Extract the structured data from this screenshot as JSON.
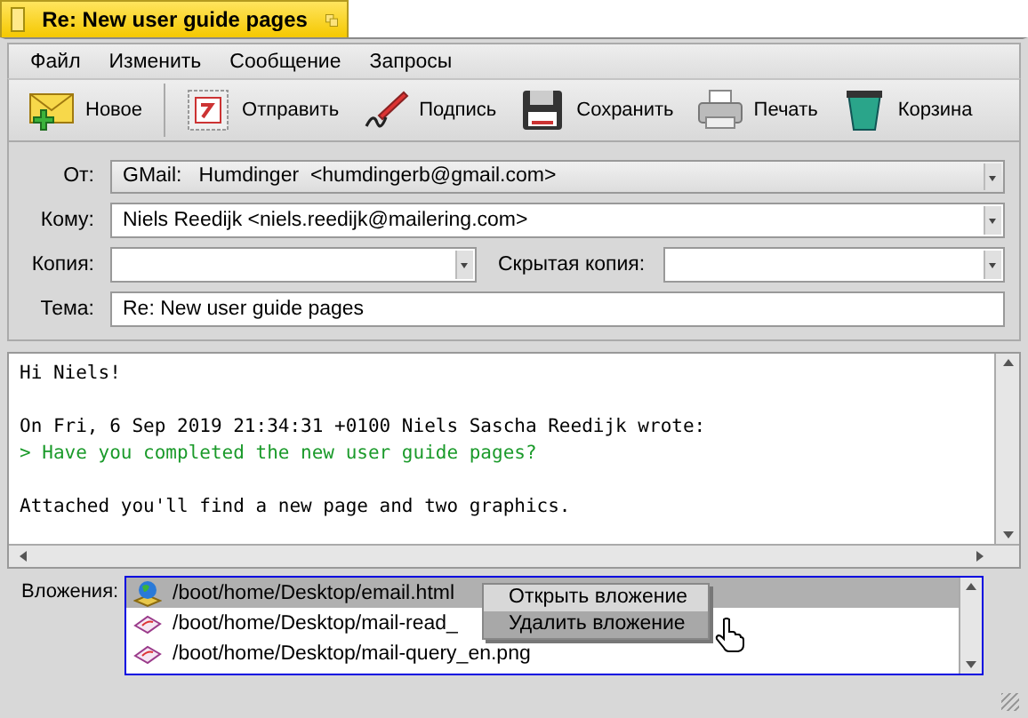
{
  "window": {
    "title": "Re: New user guide pages"
  },
  "menu": [
    "Файл",
    "Изменить",
    "Сообщение",
    "Запросы"
  ],
  "toolbar": [
    {
      "label": "Новое"
    },
    {
      "label": "Отправить"
    },
    {
      "label": "Подпись"
    },
    {
      "label": "Сохранить"
    },
    {
      "label": "Печать"
    },
    {
      "label": "Корзина"
    }
  ],
  "from": {
    "label": "От:",
    "value": "GMail:   Humdinger  <humdingerb@gmail.com>"
  },
  "to": {
    "label": "Кому:",
    "value": "Niels Reedijk <niels.reedijk@mailering.com>"
  },
  "cc": {
    "label": "Копия:"
  },
  "bcc": {
    "label": "Скрытая копия:"
  },
  "subject": {
    "label": "Тема:",
    "value": "Re: New user guide pages"
  },
  "body": [
    {
      "lines": [
        {
          "kind": "plain",
          "text": "Hi Niels!"
        }
      ]
    },
    {
      "lines": [
        {
          "kind": "plain",
          "text": "On Fri, 6 Sep 2019 21:34:31 +0100 Niels Sascha Reedijk wrote:"
        },
        {
          "kind": "quote",
          "text": "> Have you completed the new user guide pages?"
        }
      ]
    },
    {
      "lines": [
        {
          "kind": "plain",
          "text": "Attached you'll find a new page and two graphics."
        }
      ]
    }
  ],
  "attachments": {
    "label": "Вложения:",
    "items": [
      {
        "kind": "html",
        "name": "/boot/home/Desktop/email.html",
        "selected": true
      },
      {
        "kind": "image",
        "name": "/boot/home/Desktop/mail-read_",
        "selected": false
      },
      {
        "kind": "image",
        "name": "/boot/home/Desktop/mail-query_en.png",
        "selected": false
      }
    ]
  },
  "context_menu": [
    {
      "label": "Открыть вложение",
      "highlighted": false
    },
    {
      "label": "Удалить вложение",
      "highlighted": true
    }
  ]
}
